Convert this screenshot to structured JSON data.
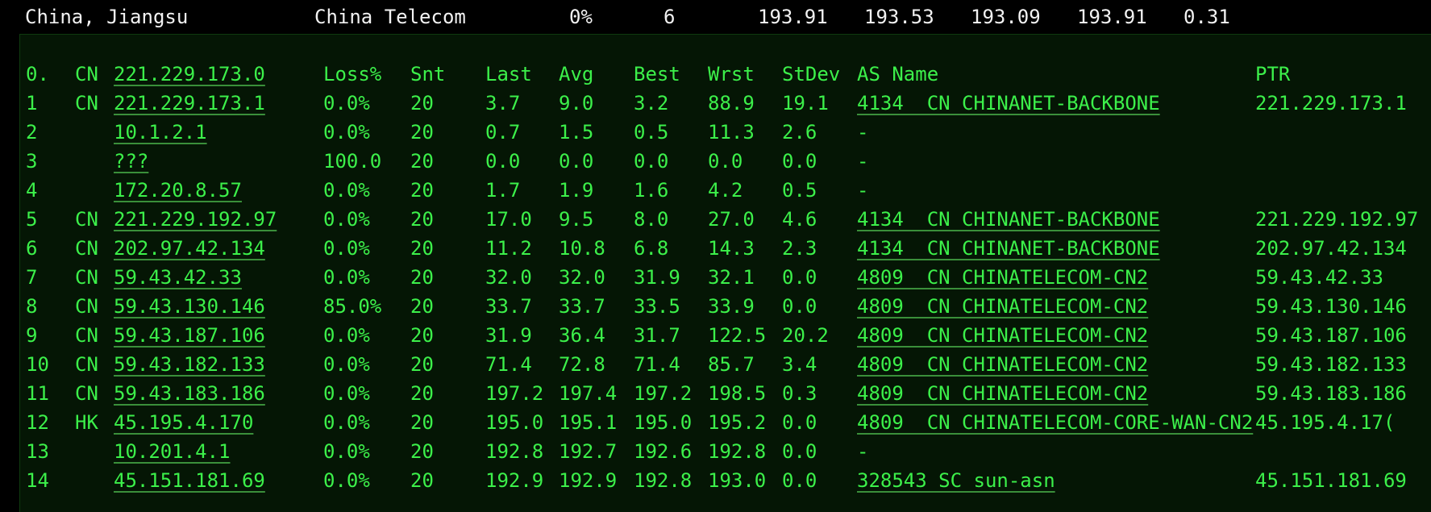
{
  "summary": {
    "location": "China, Jiangsu",
    "isp": "China Telecom",
    "loss": "0%",
    "sent": "6",
    "v1": "193.91",
    "v2": "193.53",
    "v3": "193.09",
    "v4": "193.91",
    "v5": "0.31"
  },
  "headers": {
    "hop": "0.",
    "cc": "CN",
    "host": "221.229.173.0",
    "loss": "Loss%",
    "snt": "Snt",
    "last": "Last",
    "avg": "Avg",
    "best": "Best",
    "wrst": "Wrst",
    "stdev": "StDev",
    "as": "AS Name",
    "ptr": "PTR"
  },
  "hops": [
    {
      "hop": "1",
      "cc": "CN",
      "host": "221.229.173.1",
      "loss": "0.0%",
      "snt": "20",
      "last": "3.7",
      "avg": "9.0",
      "best": "3.2",
      "wrst": "88.9",
      "stdev": "19.1",
      "as": "4134  CN CHINANET-BACKBONE",
      "ptr": "221.229.173.1"
    },
    {
      "hop": "2",
      "cc": "",
      "host": "10.1.2.1",
      "loss": "0.0%",
      "snt": "20",
      "last": "0.7",
      "avg": "1.5",
      "best": "0.5",
      "wrst": "11.3",
      "stdev": "2.6",
      "as": "-",
      "ptr": ""
    },
    {
      "hop": "3",
      "cc": "",
      "host": "???",
      "loss": "100.0",
      "snt": "20",
      "last": "0.0",
      "avg": "0.0",
      "best": "0.0",
      "wrst": "0.0",
      "stdev": "0.0",
      "as": "-",
      "ptr": ""
    },
    {
      "hop": "4",
      "cc": "",
      "host": "172.20.8.57",
      "loss": "0.0%",
      "snt": "20",
      "last": "1.7",
      "avg": "1.9",
      "best": "1.6",
      "wrst": "4.2",
      "stdev": "0.5",
      "as": "-",
      "ptr": ""
    },
    {
      "hop": "5",
      "cc": "CN",
      "host": "221.229.192.97",
      "loss": "0.0%",
      "snt": "20",
      "last": "17.0",
      "avg": "9.5",
      "best": "8.0",
      "wrst": "27.0",
      "stdev": "4.6",
      "as": "4134  CN CHINANET-BACKBONE",
      "ptr": "221.229.192.97"
    },
    {
      "hop": "6",
      "cc": "CN",
      "host": "202.97.42.134",
      "loss": "0.0%",
      "snt": "20",
      "last": "11.2",
      "avg": "10.8",
      "best": "6.8",
      "wrst": "14.3",
      "stdev": "2.3",
      "as": "4134  CN CHINANET-BACKBONE",
      "ptr": "202.97.42.134"
    },
    {
      "hop": "7",
      "cc": "CN",
      "host": "59.43.42.33",
      "loss": "0.0%",
      "snt": "20",
      "last": "32.0",
      "avg": "32.0",
      "best": "31.9",
      "wrst": "32.1",
      "stdev": "0.0",
      "as": "4809  CN CHINATELECOM-CN2",
      "ptr": "59.43.42.33"
    },
    {
      "hop": "8",
      "cc": "CN",
      "host": "59.43.130.146",
      "loss": "85.0%",
      "snt": "20",
      "last": "33.7",
      "avg": "33.7",
      "best": "33.5",
      "wrst": "33.9",
      "stdev": "0.0",
      "as": "4809  CN CHINATELECOM-CN2",
      "ptr": "59.43.130.146"
    },
    {
      "hop": "9",
      "cc": "CN",
      "host": "59.43.187.106",
      "loss": "0.0%",
      "snt": "20",
      "last": "31.9",
      "avg": "36.4",
      "best": "31.7",
      "wrst": "122.5",
      "stdev": "20.2",
      "as": "4809  CN CHINATELECOM-CN2",
      "ptr": "59.43.187.106"
    },
    {
      "hop": "10",
      "cc": "CN",
      "host": "59.43.182.133",
      "loss": "0.0%",
      "snt": "20",
      "last": "71.4",
      "avg": "72.8",
      "best": "71.4",
      "wrst": "85.7",
      "stdev": "3.4",
      "as": "4809  CN CHINATELECOM-CN2",
      "ptr": "59.43.182.133"
    },
    {
      "hop": "11",
      "cc": "CN",
      "host": "59.43.183.186",
      "loss": "0.0%",
      "snt": "20",
      "last": "197.2",
      "avg": "197.4",
      "best": "197.2",
      "wrst": "198.5",
      "stdev": "0.3",
      "as": "4809  CN CHINATELECOM-CN2",
      "ptr": "59.43.183.186"
    },
    {
      "hop": "12",
      "cc": "HK",
      "host": "45.195.4.170",
      "loss": "0.0%",
      "snt": "20",
      "last": "195.0",
      "avg": "195.1",
      "best": "195.0",
      "wrst": "195.2",
      "stdev": "0.0",
      "as": "4809  CN CHINATELECOM-CORE-WAN-CN2",
      "ptr": "45.195.4.17("
    },
    {
      "hop": "13",
      "cc": "",
      "host": "10.201.4.1",
      "loss": "0.0%",
      "snt": "20",
      "last": "192.8",
      "avg": "192.7",
      "best": "192.6",
      "wrst": "192.8",
      "stdev": "0.0",
      "as": "-",
      "ptr": ""
    },
    {
      "hop": "14",
      "cc": "",
      "host": "45.151.181.69",
      "loss": "0.0%",
      "snt": "20",
      "last": "192.9",
      "avg": "192.9",
      "best": "192.8",
      "wrst": "193.0",
      "stdev": "0.0",
      "as": "328543 SC sun-asn",
      "ptr": "45.151.181.69"
    }
  ]
}
